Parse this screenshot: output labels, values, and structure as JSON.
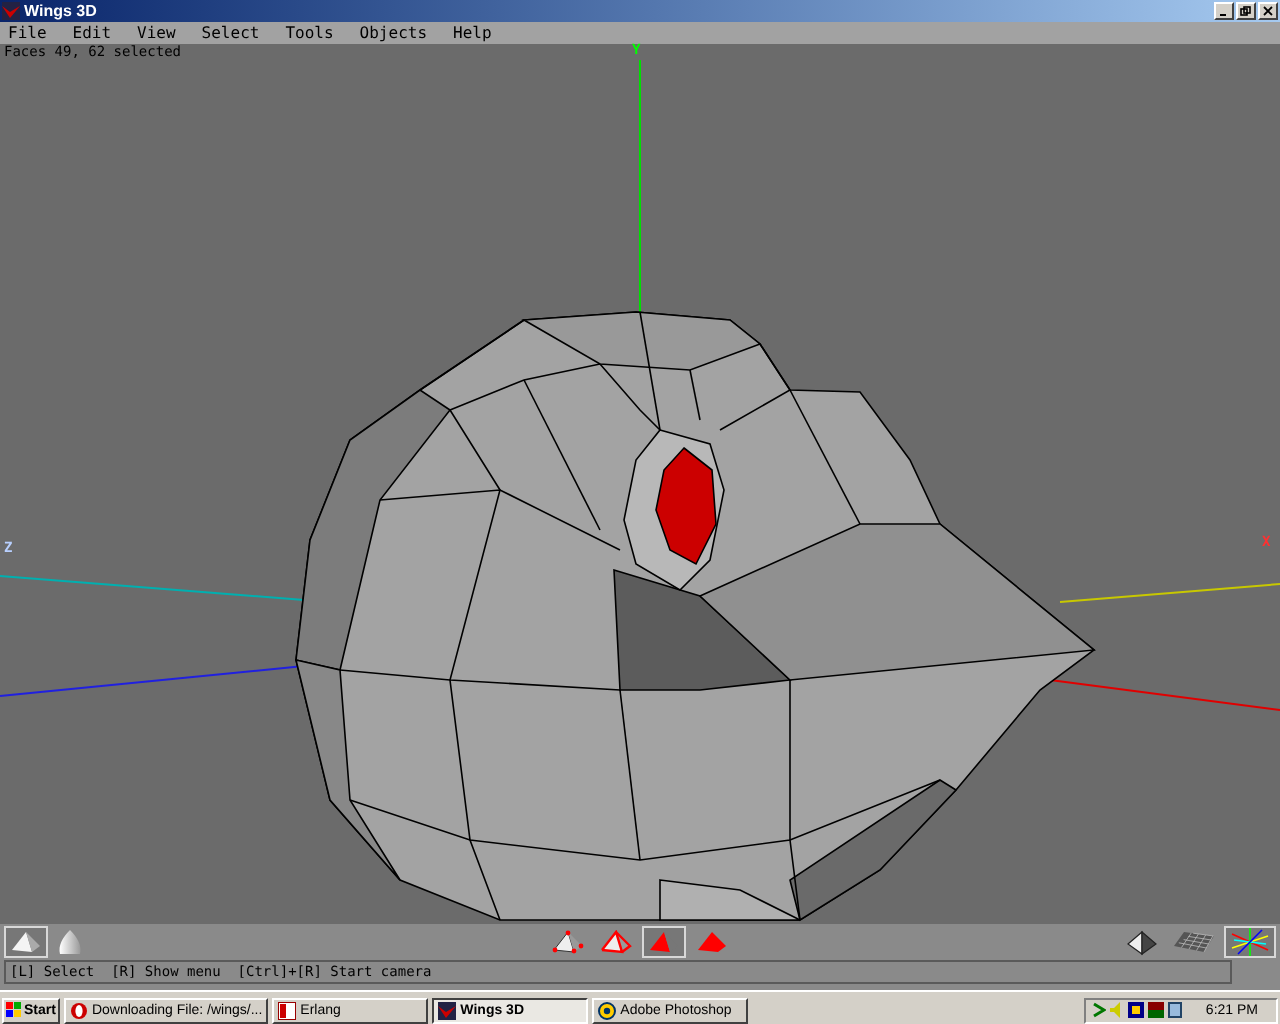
{
  "window": {
    "title": "Wings 3D"
  },
  "menu": [
    "File",
    "Edit",
    "View",
    "Select",
    "Tools",
    "Objects",
    "Help"
  ],
  "viewport": {
    "info": "Faces 49, 62 selected",
    "axis_labels": [
      {
        "kind": "y",
        "label": "Y"
      },
      {
        "kind": "z",
        "label": "Z"
      },
      {
        "kind": "x",
        "label": "X"
      }
    ]
  },
  "toolbar": {
    "shading": [
      {
        "kind": "flat",
        "selected": true
      },
      {
        "kind": "smooth",
        "selected": false
      }
    ],
    "select_modes": [
      {
        "kind": "vertex",
        "selected": false
      },
      {
        "kind": "edge",
        "selected": false
      },
      {
        "kind": "face",
        "selected": true
      },
      {
        "kind": "body",
        "selected": false
      }
    ],
    "views": [
      {
        "kind": "solid",
        "selected": false
      },
      {
        "kind": "ground",
        "selected": false
      },
      {
        "kind": "axes",
        "selected": true
      }
    ]
  },
  "status_bar": "[L] Select  [R] Show menu  [Ctrl]+[R] Start camera",
  "taskbar": {
    "start": "Start",
    "tasks": [
      {
        "kind": "browser",
        "label": "Downloading File: /wings/...",
        "selected": false
      },
      {
        "kind": "erlang",
        "label": "Erlang",
        "selected": false
      },
      {
        "kind": "wings",
        "label": "Wings 3D",
        "selected": true
      },
      {
        "kind": "photoshop",
        "label": "Adobe Photoshop",
        "selected": false
      }
    ],
    "clock": "6:21 PM"
  }
}
